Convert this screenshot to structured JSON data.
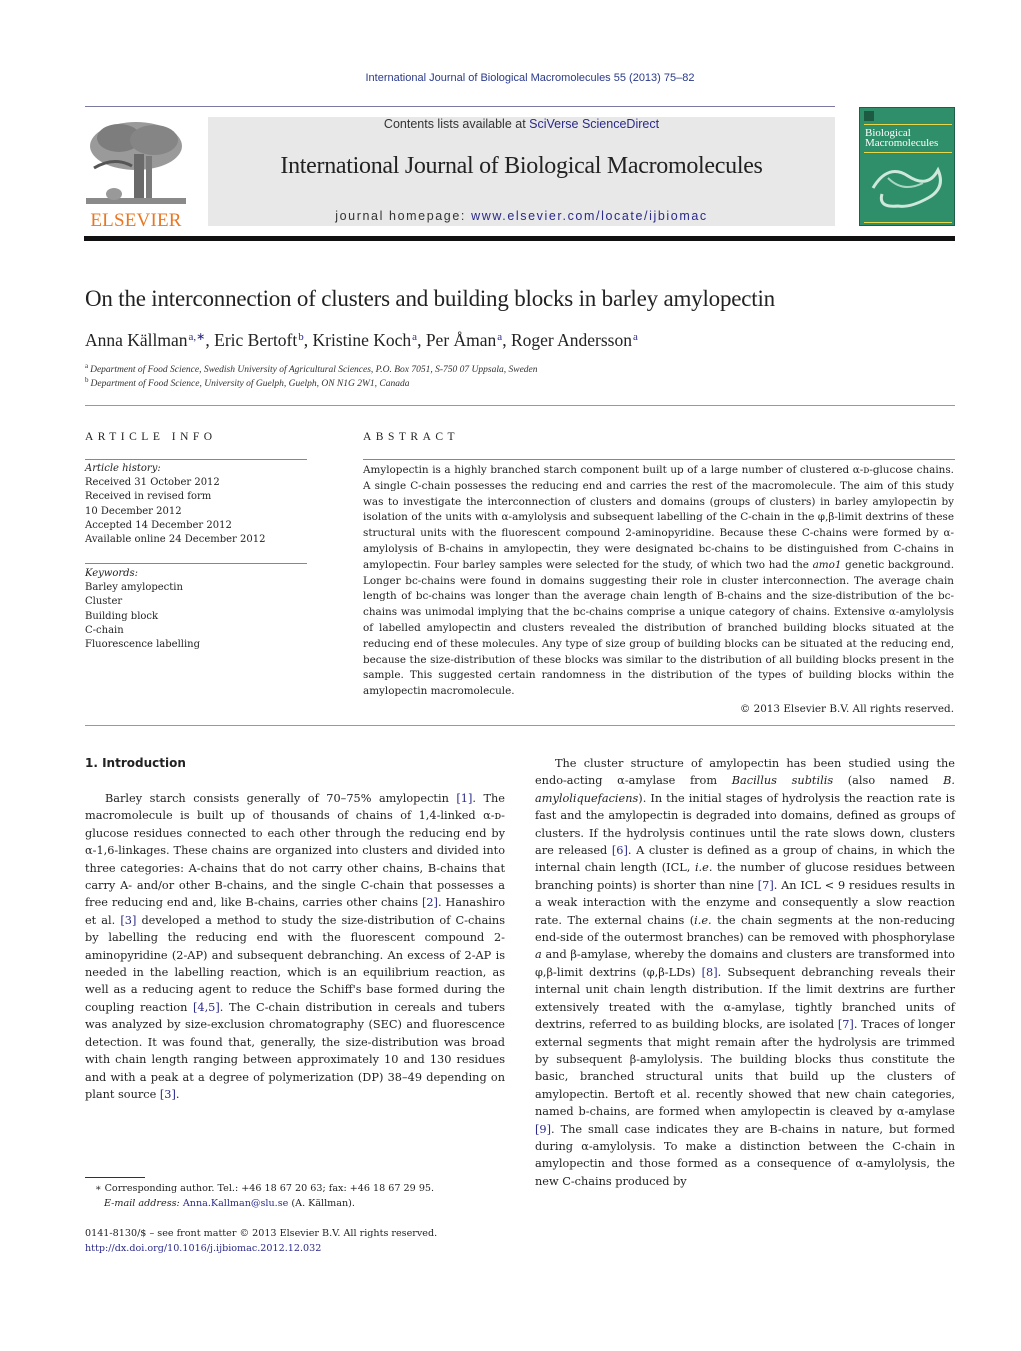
{
  "header": {
    "journal_reference": "International Journal of Biological Macromolecules 55 (2013) 75–82",
    "contents_prefix": "Contents lists available at ",
    "contents_link": "SciVerse ScienceDirect",
    "journal_title": "International Journal of Biological Macromolecules",
    "homepage_prefix": "journal homepage: ",
    "homepage_link": "www.elsevier.com/locate/ijbiomac",
    "publisher_logo_text": "ELSEVIER",
    "cover_title_line1": "Biological",
    "cover_title_line2": "Macromolecules",
    "brand_color": "#e87722",
    "link_color": "#2a2a8a",
    "cover_color": "#2f8f6a"
  },
  "article": {
    "title": "On the interconnection of clusters and building blocks in barley amylopectin",
    "authors": [
      {
        "name": "Anna Källman",
        "sup": "a,∗"
      },
      {
        "name": "Eric Bertoft",
        "sup": "b"
      },
      {
        "name": "Kristine Koch",
        "sup": "a"
      },
      {
        "name": "Per Åman",
        "sup": "a"
      },
      {
        "name": "Roger Andersson",
        "sup": "a"
      }
    ],
    "affiliations": [
      {
        "mark": "a",
        "text": "Department of Food Science, Swedish University of Agricultural Sciences, P.O. Box 7051, S-750 07 Uppsala, Sweden"
      },
      {
        "mark": "b",
        "text": "Department of Food Science, University of Guelph, Guelph, ON N1G 2W1, Canada"
      }
    ]
  },
  "article_info": {
    "heading": "ARTICLE INFO",
    "history_label": "Article history:",
    "history": [
      "Received 31 October 2012",
      "Received in revised form",
      "10 December 2012",
      "Accepted 14 December 2012",
      "Available online 24 December 2012"
    ],
    "keywords_label": "Keywords:",
    "keywords": [
      "Barley amylopectin",
      "Cluster",
      "Building block",
      "C-chain",
      "Fluorescence labelling"
    ]
  },
  "abstract": {
    "heading": "ABSTRACT",
    "text_1": "Amylopectin is a highly branched starch component built up of a large number of clustered α-ᴅ-glucose chains. A single C-chain possesses the reducing end and carries the rest of the macromolecule. The aim of this study was to investigate the interconnection of clusters and domains (groups of clusters) in barley amylopectin by isolation of the units with α-amylolysis and subsequent labelling of the C-chain in the φ,β-limit dextrins of these structural units with the fluorescent compound 2-aminopyridine. Because these C-chains were formed by α-amylolysis of B-chains in amylopectin, they were designated bc-chains to be distinguished from C-chains in amylopectin. Four barley samples were selected for the study, of which two had the ",
    "text_italic": "amo1",
    "text_2": " genetic background. Longer bc-chains were found in domains suggesting their role in cluster interconnection. The average chain length of bc-chains was longer than the average chain length of B-chains and the size-distribution of the bc-chains was unimodal implying that the bc-chains comprise a unique category of chains. Extensive α-amylolysis of labelled amylopectin and clusters revealed the distribution of branched building blocks situated at the reducing end of these molecules. Any type of size group of building blocks can be situated at the reducing end, because the size-distribution of these blocks was similar to the distribution of all building blocks present in the sample. This suggested certain randomness in the distribution of the types of building blocks within the amylopectin macromolecule.",
    "copyright": "© 2013 Elsevier B.V. All rights reserved."
  },
  "introduction": {
    "heading": "1.  Introduction",
    "left_p1_a": "Barley starch consists generally of 70–75% amylopectin ",
    "ref1": "[1]",
    "left_p1_b": ". The macromolecule is built up of thousands of chains of 1,4-linked α-ᴅ-glucose residues connected to each other through the reducing end by α-1,6-linkages. These chains are organized into clusters and divided into three categories: A-chains that do not carry other chains, B-chains that carry A- and/or other B-chains, and the single C-chain that possesses a free reducing end and, like B-chains, carries other chains ",
    "ref2": "[2]",
    "left_p1_c": ". Hanashiro et al. ",
    "ref3": "[3]",
    "left_p1_d": " developed a method to study the size-distribution of C-chains by labelling the reducing end with the fluorescent compound 2-aminopyridine (2-AP) and subsequent debranching. An excess of 2-AP is needed in the labelling reaction, which is an equilibrium reaction, as well as a reducing agent to reduce the Schiff's base formed during the coupling reaction ",
    "ref45": "[4,5]",
    "left_p1_e": ". The C-chain distribution in cereals and tubers was analyzed by size-exclusion chromatography (SEC) and fluorescence detection. It was found that, generally, the size-distribution was broad with chain length ranging between approximately 10 and 130 residues and with a peak at a degree of polymerization (DP) 38–49 depending on plant source ",
    "ref3b": "[3]",
    "left_p1_f": ".",
    "right_a": "The cluster structure of amylopectin has been studied using the endo-acting α-amylase from ",
    "right_it1": "Bacillus subtilis",
    "right_b": " (also named ",
    "right_it2": "B. amyloliquefaciens",
    "right_c": "). In the initial stages of hydrolysis the reaction rate is fast and the amylopectin is degraded into domains, defined as groups of clusters. If the hydrolysis continues until the rate slows down, clusters are released ",
    "ref6": "[6]",
    "right_d": ". A cluster is defined as a group of chains, in which the internal chain length (ICL, ",
    "right_it3": "i.e.",
    "right_e": " the number of glucose residues between branching points) is shorter than nine ",
    "ref7": "[7]",
    "right_f": ". An ICL < 9 residues results in a weak interaction with the enzyme and consequently a slow reaction rate. The external chains (",
    "right_it4": "i.e.",
    "right_g": " the chain segments at the non-reducing end-side of the outermost branches) can be removed with phosphorylase ",
    "right_it5": "a",
    "right_h": " and β-amylase, whereby the domains and clusters are transformed into φ,β-limit dextrins (φ,β-LDs) ",
    "ref8": "[8]",
    "right_i": ". Subsequent debranching reveals their internal unit chain length distribution. If the limit dextrins are further extensively treated with the α-amylase, tightly branched units of dextrins, referred to as building blocks, are isolated ",
    "ref7b": "[7]",
    "right_j": ". Traces of longer external segments that might remain after the hydrolysis are trimmed by subsequent β-amylolysis. The building blocks thus constitute the basic, branched structural units that build up the clusters of amylopectin. Bertoft et al. recently showed that new chain categories, named b-chains, are formed when amylopectin is cleaved by α-amylase ",
    "ref9": "[9]",
    "right_k": ". The small case indicates they are B-chains in nature, but formed during α-amylolysis. To make a distinction between the C-chain in amylopectin and those formed as a consequence of α-amylolysis, the new C-chains produced by"
  },
  "footnotes": {
    "star": "∗",
    "corresponding": "Corresponding author. Tel.: +46 18 67 20 63; fax: +46 18 67 29 95.",
    "email_label": "E-mail address:",
    "email": "Anna.Kallman@slu.se",
    "email_suffix": " (A. Källman).",
    "front_matter": "0141-8130/$ – see front matter © 2013 Elsevier B.V. All rights reserved.",
    "doi": "http://dx.doi.org/10.1016/j.ijbiomac.2012.12.032"
  }
}
